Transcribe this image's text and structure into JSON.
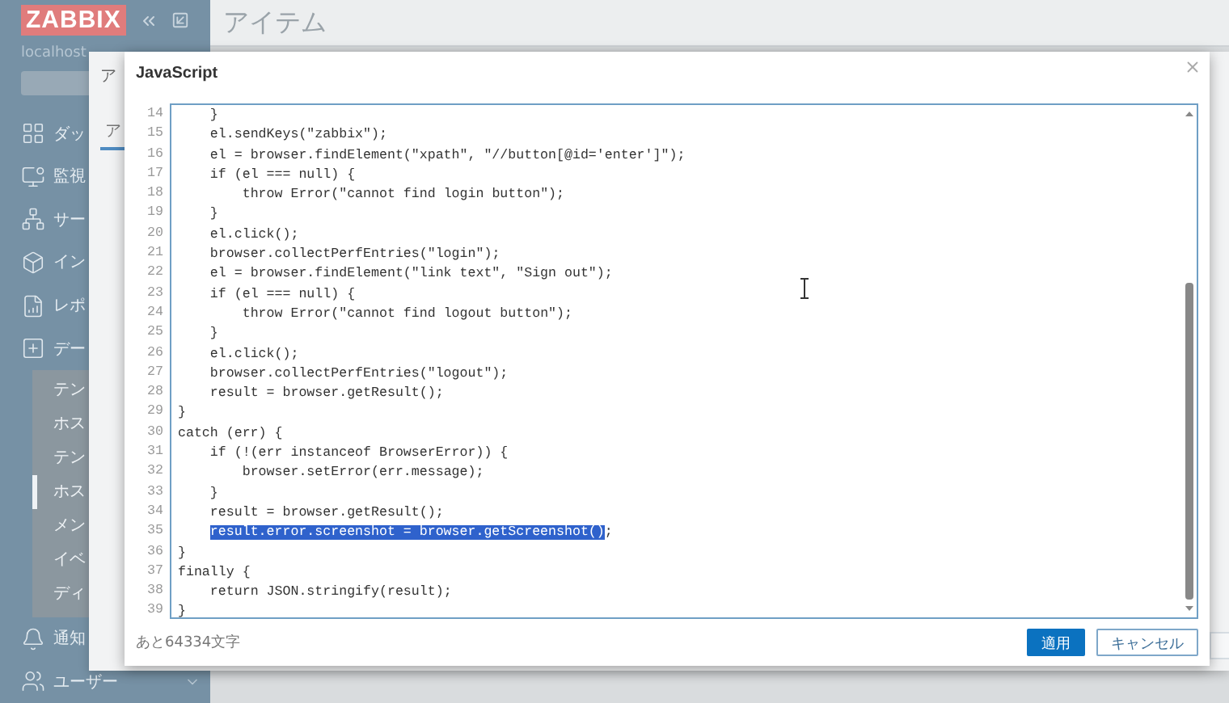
{
  "sidebar": {
    "logo": "ZABBIX",
    "server": "localhost",
    "items": [
      {
        "label": "ダッ"
      },
      {
        "label": "監視"
      },
      {
        "label": "サー"
      },
      {
        "label": "イン"
      },
      {
        "label": "レポ"
      },
      {
        "label": "デー",
        "expanded": true,
        "children": [
          {
            "label": "テン",
            "selected": false
          },
          {
            "label": "ホス",
            "selected": false
          },
          {
            "label": "テン",
            "selected": false
          },
          {
            "label": "ホス",
            "selected": true
          },
          {
            "label": "メン",
            "selected": false
          },
          {
            "label": "イベ",
            "selected": false
          },
          {
            "label": "ディ",
            "selected": false
          }
        ]
      },
      {
        "label": "通知"
      },
      {
        "label": "ユーザー"
      }
    ]
  },
  "page": {
    "title": "アイテム"
  },
  "item_dialog": {
    "title": "ア",
    "tab": "ア"
  },
  "script_dialog": {
    "title": "JavaScript",
    "lines": [
      {
        "number": "14",
        "text": "    }",
        "selected": false
      },
      {
        "number": "15",
        "text": "    el.sendKeys(\"zabbix\");",
        "selected": false
      },
      {
        "number": "16",
        "text": "    el = browser.findElement(\"xpath\", \"//button[@id='enter']\");",
        "selected": false
      },
      {
        "number": "17",
        "text": "    if (el === null) {",
        "selected": false
      },
      {
        "number": "18",
        "text": "        throw Error(\"cannot find login button\");",
        "selected": false
      },
      {
        "number": "19",
        "text": "    }",
        "selected": false
      },
      {
        "number": "20",
        "text": "    el.click();",
        "selected": false
      },
      {
        "number": "21",
        "text": "    browser.collectPerfEntries(\"login\");",
        "selected": false
      },
      {
        "number": "22",
        "text": "    el = browser.findElement(\"link text\", \"Sign out\");",
        "selected": false
      },
      {
        "number": "23",
        "text": "    if (el === null) {",
        "selected": false
      },
      {
        "number": "24",
        "text": "        throw Error(\"cannot find logout button\");",
        "selected": false
      },
      {
        "number": "25",
        "text": "    }",
        "selected": false
      },
      {
        "number": "26",
        "text": "    el.click();",
        "selected": false
      },
      {
        "number": "27",
        "text": "    browser.collectPerfEntries(\"logout\");",
        "selected": false
      },
      {
        "number": "28",
        "text": "    result = browser.getResult();",
        "selected": false
      },
      {
        "number": "29",
        "text": "}",
        "selected": false
      },
      {
        "number": "30",
        "text": "catch (err) {",
        "selected": false
      },
      {
        "number": "31",
        "text": "    if (!(err instanceof BrowserError)) {",
        "selected": false
      },
      {
        "number": "32",
        "text": "        browser.setError(err.message);",
        "selected": false
      },
      {
        "number": "33",
        "text": "    }",
        "selected": false
      },
      {
        "number": "34",
        "text": "    result = browser.getResult();",
        "selected": false
      },
      {
        "number": "35",
        "text": "    result.error.screenshot = browser.getScreenshot();",
        "selected": true
      },
      {
        "number": "36",
        "text": "}",
        "selected": false
      },
      {
        "number": "37",
        "text": "finally {",
        "selected": false
      },
      {
        "number": "38",
        "text": "    return JSON.stringify(result);",
        "selected": false
      },
      {
        "number": "39",
        "text": "}",
        "selected": false
      }
    ],
    "remaining": "あと64334文字",
    "buttons": [
      {
        "label": "適用",
        "kind": "primary"
      },
      {
        "label": "キャンセル",
        "kind": "secondary"
      }
    ]
  }
}
